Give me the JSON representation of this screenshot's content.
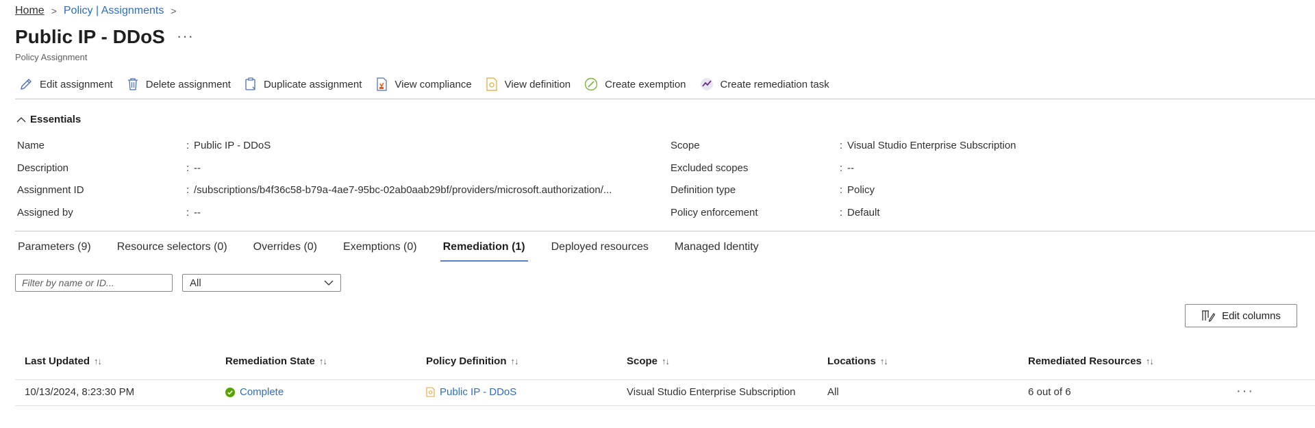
{
  "breadcrumb": {
    "home": "Home",
    "items": [
      "Policy | Assignments"
    ]
  },
  "page": {
    "title": "Public IP - DDoS",
    "more": "···",
    "subtitle": "Policy Assignment"
  },
  "toolbar": {
    "edit": "Edit assignment",
    "delete": "Delete assignment",
    "duplicate": "Duplicate assignment",
    "view_compliance": "View compliance",
    "view_definition": "View definition",
    "create_exemption": "Create exemption",
    "create_remediation": "Create remediation task"
  },
  "essentials": {
    "title": "Essentials",
    "left": [
      {
        "label": "Name",
        "value": "Public IP - DDoS"
      },
      {
        "label": "Description",
        "value": "--"
      },
      {
        "label": "Assignment ID",
        "value": "/subscriptions/b4f36c58-b79a-4ae7-95bc-02ab0aab29bf/providers/microsoft.authorization/..."
      },
      {
        "label": "Assigned by",
        "value": "--"
      }
    ],
    "right": [
      {
        "label": "Scope",
        "value": "Visual Studio Enterprise Subscription"
      },
      {
        "label": "Excluded scopes",
        "value": "--"
      },
      {
        "label": "Definition type",
        "value": "Policy"
      },
      {
        "label": "Policy enforcement",
        "value": "Default"
      }
    ]
  },
  "tabs": [
    {
      "label": "Parameters (9)"
    },
    {
      "label": "Resource selectors (0)"
    },
    {
      "label": "Overrides (0)"
    },
    {
      "label": "Exemptions (0)"
    },
    {
      "label": "Remediation (1)",
      "active": true
    },
    {
      "label": "Deployed resources"
    },
    {
      "label": "Managed Identity"
    }
  ],
  "filter": {
    "placeholder": "Filter by name or ID...",
    "state_value": "All"
  },
  "edit_columns": "Edit columns",
  "table": {
    "columns": [
      "Last Updated",
      "Remediation State",
      "Policy Definition",
      "Scope",
      "Locations",
      "Remediated Resources"
    ],
    "rows": [
      {
        "last_updated": "10/13/2024, 8:23:30 PM",
        "state": "Complete",
        "definition": "Public IP - DDoS",
        "scope": "Visual Studio Enterprise Subscription",
        "locations": "All",
        "remediated": "6 out of 6"
      }
    ],
    "row_more": "···"
  },
  "colors": {
    "link": "#2f6dbf",
    "success": "#57a300",
    "tab_underline": "#5b7fc7"
  }
}
